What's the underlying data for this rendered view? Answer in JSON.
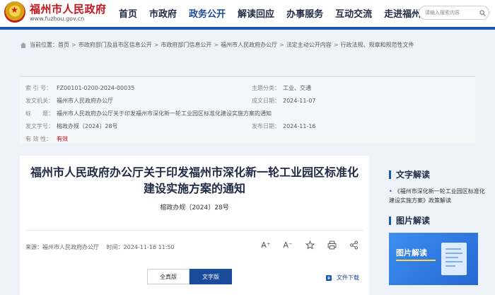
{
  "header": {
    "site_title": "福州市人民政府",
    "site_url": "www.fuzhou.gov.cn",
    "nav": [
      "首页",
      "市政府",
      "政务公开",
      "解读回应",
      "办事服务",
      "互动交流",
      "走进福州"
    ],
    "search_placeholder": "请输入搜索内容"
  },
  "breadcrumb": {
    "label": "当前位置：",
    "items": [
      "首页",
      "市政府部门及县市区信息公开",
      "市政府部门信息公开",
      "福州市人民政府办公厅",
      "法定主动公开内容",
      "行政法规、规章和规范性文件"
    ],
    "separator": ">"
  },
  "meta": {
    "index_label": "索 引 号：",
    "index_value": "FZ00101-0200-2024-00035",
    "topic_label": "主题分类：",
    "topic_value": "工业、交通",
    "issuer_label": "发文机关：",
    "issuer_value": "福州市人民政府办公厅",
    "created_label": "成文日期：",
    "created_value": "2024-11-07",
    "title_label": "标　　题：",
    "title_value": "福州市人民政府办公厅关于印发福州市深化新一轮工业园区标准化建设实施方案的通知",
    "docno_label": "发文字号：",
    "docno_value": "榕政办规〔2024〕28号",
    "published_label": "发布日期：",
    "published_value": "2024-11-16",
    "validity_label": "有 效 性：",
    "validity_value": "有效"
  },
  "article": {
    "title": "福州市人民政府办公厅关于印发福州市深化新一轮工业园区标准化建设实施方案的通知",
    "doc_number": "榕政办规〔2024〕28号",
    "source": "来源：福州市人民政府办公厅",
    "time": "时间：2024-11-16 11:50",
    "font_up": "A⁺",
    "font_down": "A⁻",
    "version_full": "全真版",
    "version_text": "文字版",
    "download": "文件下载"
  },
  "sidebar": {
    "text_interpretation": "文字解读",
    "text_link": "《福州市深化新一轮工业园区标准化建设实施方案》政策解读",
    "image_interpretation": "图片解读",
    "banner_text": "图片解读"
  },
  "colors": {
    "brand_red": "#c4161c",
    "brand_blue": "#1a57b3",
    "active_nav": "#1a4a9a",
    "validity": "#d0021b"
  },
  "icons": [
    "emblem-icon",
    "search-icon",
    "home-icon",
    "star-icon",
    "print-icon",
    "share-icon",
    "download-icon"
  ]
}
